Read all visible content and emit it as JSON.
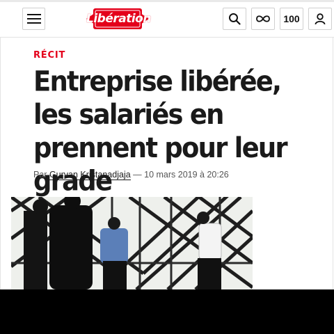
{
  "header": {
    "logo_text": "Libération",
    "count_label": "100",
    "icons": [
      "menu-icon",
      "search-icon",
      "infinity-icon",
      "user-icon"
    ]
  },
  "article": {
    "kicker": "RÉCIT",
    "headline": "Entreprise libérée, les salariés en prennent pour leur grade",
    "byline_prefix": "Par ",
    "author": "Gurvan Kristanadjaja",
    "byline_suffix": " — 10 mars 2019 à 20:26"
  },
  "colors": {
    "brand_red": "#e4001b",
    "text": "#1a1a1a"
  }
}
